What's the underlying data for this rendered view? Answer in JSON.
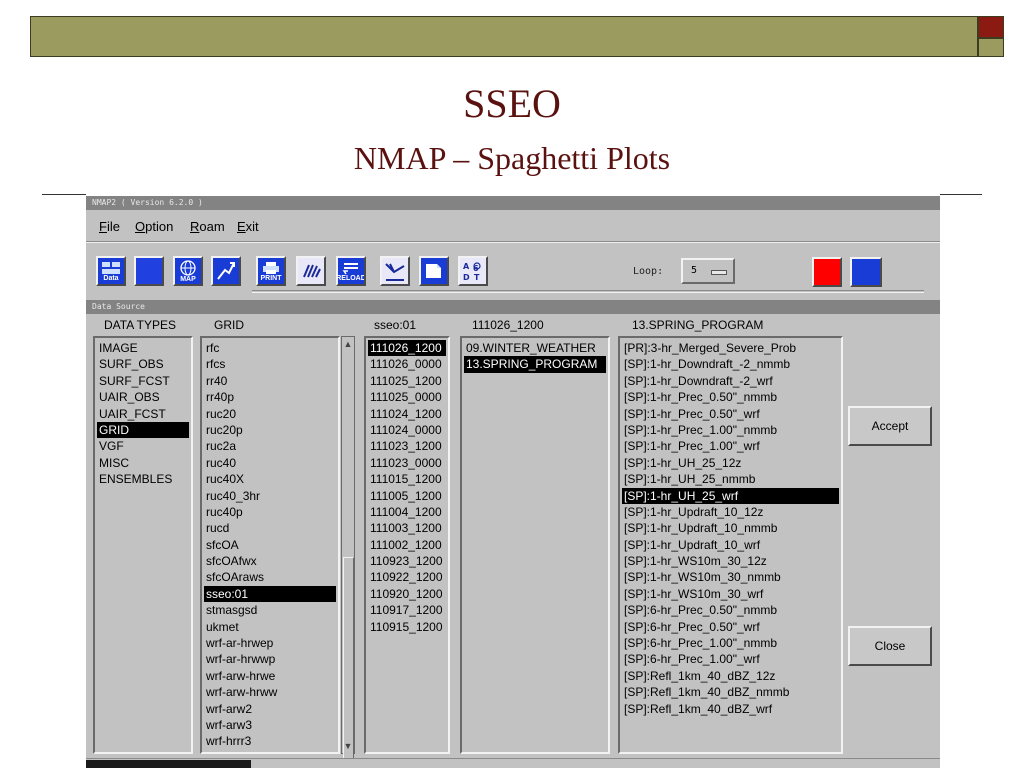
{
  "slide": {
    "title": "SSEO",
    "subtitle": "NMAP – Spaghetti Plots"
  },
  "window": {
    "title": "NMAP2 ( Version 6.2.0 )",
    "menu": [
      {
        "u": "F",
        "rest": "ile"
      },
      {
        "u": "O",
        "rest": "ption"
      },
      {
        "u": "R",
        "rest": "oam"
      },
      {
        "u": "E",
        "rest": "xit"
      }
    ]
  },
  "toolbar": {
    "data_label": "Data",
    "map_label": "MAP",
    "print_label": "PRINT",
    "reload_label": "RELOAD",
    "loop_label": "Loop:",
    "loop_value": "5",
    "colors": {
      "red": "#ff0000",
      "blue": "#1a3cd6"
    }
  },
  "data_source": {
    "header": "Data Source",
    "col_data_types": "DATA TYPES",
    "col_grid": "GRID",
    "col_source": "sseo:01",
    "col_cycle": "111026_1200",
    "col_group": "13.SPRING_PROGRAM",
    "data_types": [
      "IMAGE",
      "SURF_OBS",
      "SURF_FCST",
      "UAIR_OBS",
      "UAIR_FCST",
      "GRID",
      "VGF",
      "MISC",
      "ENSEMBLES"
    ],
    "grid": [
      "rfc",
      "rfcs",
      "rr40",
      "rr40p",
      "ruc20",
      "ruc20p",
      "ruc2a",
      "ruc40",
      "ruc40X",
      "ruc40_3hr",
      "ruc40p",
      "rucd",
      "sfcOA",
      "sfcOAfwx",
      "sfcOAraws",
      "sseo:01",
      "stmasgsd",
      "ukmet",
      "wrf-ar-hrwep",
      "wrf-ar-hrwwp",
      "wrf-arw-hrwe",
      "wrf-arw-hrww",
      "wrf-arw2",
      "wrf-arw3",
      "wrf-hrrr3"
    ],
    "cycles": [
      "111026_1200",
      "111026_0000",
      "111025_1200",
      "111025_0000",
      "111024_1200",
      "111024_0000",
      "111023_1200",
      "111023_0000",
      "111015_1200",
      "111005_1200",
      "111004_1200",
      "111003_1200",
      "111002_1200",
      "110923_1200",
      "110922_1200",
      "110920_1200",
      "110917_1200",
      "110915_1200"
    ],
    "groups": [
      "09.WINTER_WEATHER",
      "13.SPRING_PROGRAM"
    ],
    "products": [
      "[PR]:3-hr_Merged_Severe_Prob",
      "[SP]:1-hr_Downdraft_-2_nmmb",
      "[SP]:1-hr_Downdraft_-2_wrf",
      "[SP]:1-hr_Prec_0.50\"_nmmb",
      "[SP]:1-hr_Prec_0.50\"_wrf",
      "[SP]:1-hr_Prec_1.00\"_nmmb",
      "[SP]:1-hr_Prec_1.00\"_wrf",
      "[SP]:1-hr_UH_25_12z",
      "[SP]:1-hr_UH_25_nmmb",
      "[SP]:1-hr_UH_25_wrf",
      "[SP]:1-hr_Updraft_10_12z",
      "[SP]:1-hr_Updraft_10_nmmb",
      "[SP]:1-hr_Updraft_10_wrf",
      "[SP]:1-hr_WS10m_30_12z",
      "[SP]:1-hr_WS10m_30_nmmb",
      "[SP]:1-hr_WS10m_30_wrf",
      "[SP]:6-hr_Prec_0.50\"_nmmb",
      "[SP]:6-hr_Prec_0.50\"_wrf",
      "[SP]:6-hr_Prec_1.00\"_nmmb",
      "[SP]:6-hr_Prec_1.00\"_wrf",
      "[SP]:Refl_1km_40_dBZ_12z",
      "[SP]:Refl_1km_40_dBZ_nmmb",
      "[SP]:Refl_1km_40_dBZ_wrf"
    ],
    "selected": {
      "data_types": "GRID",
      "grid": "sseo:01",
      "cycles": "111026_1200",
      "groups": "13.SPRING_PROGRAM",
      "products": "[SP]:1-hr_UH_25_wrf"
    }
  },
  "buttons": {
    "accept": "Accept",
    "close": "Close"
  }
}
